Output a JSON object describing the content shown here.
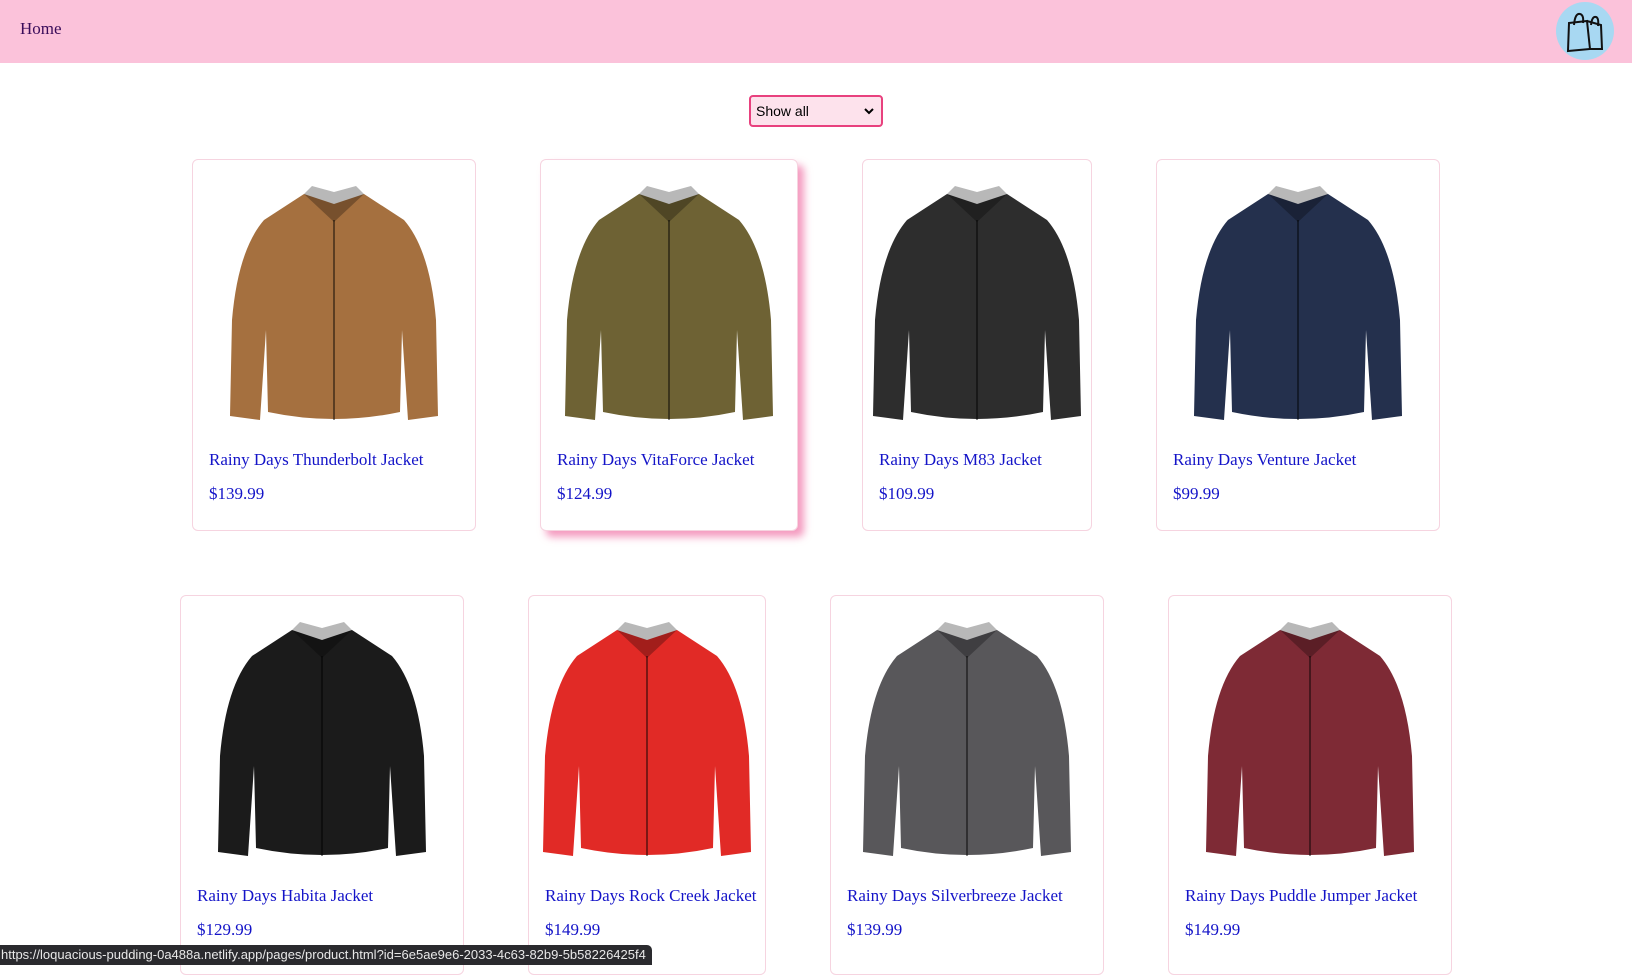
{
  "nav": {
    "home_label": "Home",
    "cart_icon": "shopping-bags-icon"
  },
  "filter": {
    "selected": "Show all"
  },
  "products": [
    {
      "name": "Rainy Days Thunderbolt Jacket",
      "price": "$139.99",
      "image_icon": "jacket-image",
      "color": "#a5703f"
    },
    {
      "name": "Rainy Days VitaForce Jacket",
      "price": "$124.99",
      "image_icon": "jacket-image",
      "color": "#6e6234"
    },
    {
      "name": "Rainy Days M83 Jacket",
      "price": "$109.99",
      "image_icon": "jacket-image",
      "color": "#2d2d2d"
    },
    {
      "name": "Rainy Days Venture Jacket",
      "price": "$99.99",
      "image_icon": "jacket-image",
      "color": "#24304d"
    },
    {
      "name": "Rainy Days Habita Jacket",
      "price": "$129.99",
      "image_icon": "jacket-image",
      "color": "#1b1b1b"
    },
    {
      "name": "Rainy Days Rock Creek Jacket",
      "price": "$149.99",
      "image_icon": "jacket-image",
      "color": "#e12a26"
    },
    {
      "name": "Rainy Days Silverbreeze Jacket",
      "price": "$139.99",
      "image_icon": "jacket-image",
      "color": "#58575a"
    },
    {
      "name": "Rainy Days Puddle Jumper Jacket",
      "price": "$149.99",
      "image_icon": "jacket-image",
      "color": "#7e2a35"
    }
  ],
  "status_url": "https://loquacious-pudding-0a488a.netlify.app/pages/product.html?id=6e5ae9e6-2033-4c63-82b9-5b58226425f4"
}
